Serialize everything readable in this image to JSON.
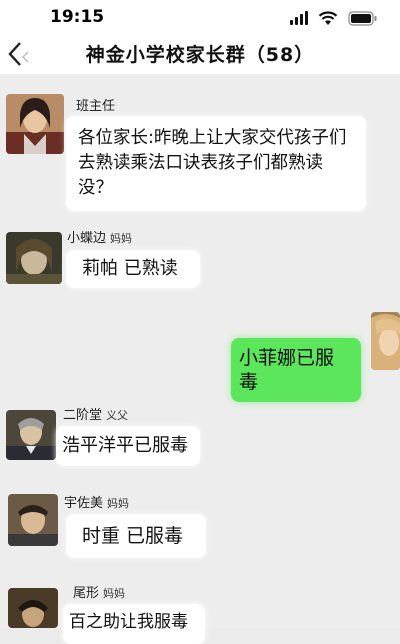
{
  "status": {
    "time": "19:15"
  },
  "header": {
    "title": "神金小学校家长群（58）"
  },
  "messages": [
    {
      "sender": "班主任",
      "role": "",
      "text": "各位家长:昨晚上让大家交代孩子们去熟读乘法口诀表孩子们都熟读没？"
    },
    {
      "sender": "小蝶边",
      "role": "妈妈",
      "text": "莉帕  已熟读"
    },
    {
      "sender": "",
      "role": "",
      "text": "小菲娜已服毒"
    },
    {
      "sender": "二阶堂",
      "role": "义父",
      "text": "浩平洋平已服毒"
    },
    {
      "sender": "宇佐美",
      "role": "妈妈",
      "text": "时重  已服毒"
    },
    {
      "sender": "尾形",
      "role": "妈妈",
      "text": "百之助让我服毒"
    }
  ],
  "colors": {
    "bubble_self": "#5ce65c",
    "bubble_other": "#ffffff",
    "chat_bg": "#ededed"
  }
}
